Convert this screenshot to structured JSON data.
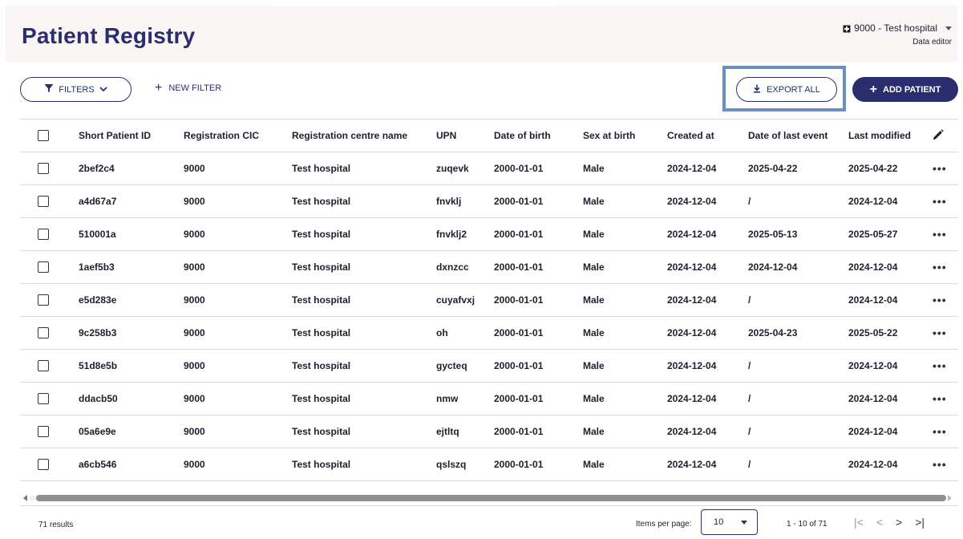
{
  "header": {
    "title": "Patient Registry",
    "hospital": "9000 - Test hospital",
    "role": "Data editor"
  },
  "toolbar": {
    "filters_label": "FILTERS",
    "new_filter_label": "NEW FILTER",
    "export_label": "EXPORT ALL",
    "add_label": "ADD PATIENT"
  },
  "table": {
    "columns": [
      "Short Patient ID",
      "Registration CIC",
      "Registration centre name",
      "UPN",
      "Date of birth",
      "Sex at birth",
      "Created at",
      "Date of last event",
      "Last modified"
    ],
    "rows": [
      [
        "2bef2c4",
        "9000",
        "Test hospital",
        "zuqevk",
        "2000-01-01",
        "Male",
        "2024-12-04",
        "2025-04-22",
        "2025-04-22"
      ],
      [
        "a4d67a7",
        "9000",
        "Test hospital",
        "fnvklj",
        "2000-01-01",
        "Male",
        "2024-12-04",
        "/",
        "2024-12-04"
      ],
      [
        "510001a",
        "9000",
        "Test hospital",
        "fnvklj2",
        "2000-01-01",
        "Male",
        "2024-12-04",
        "2025-05-13",
        "2025-05-27"
      ],
      [
        "1aef5b3",
        "9000",
        "Test hospital",
        "dxnzcc",
        "2000-01-01",
        "Male",
        "2024-12-04",
        "2024-12-04",
        "2024-12-04"
      ],
      [
        "e5d283e",
        "9000",
        "Test hospital",
        "cuyafvxj",
        "2000-01-01",
        "Male",
        "2024-12-04",
        "/",
        "2024-12-04"
      ],
      [
        "9c258b3",
        "9000",
        "Test hospital",
        "oh",
        "2000-01-01",
        "Male",
        "2024-12-04",
        "2025-04-23",
        "2025-05-22"
      ],
      [
        "51d8e5b",
        "9000",
        "Test hospital",
        "gycteq",
        "2000-01-01",
        "Male",
        "2024-12-04",
        "/",
        "2024-12-04"
      ],
      [
        "ddacb50",
        "9000",
        "Test hospital",
        "nmw",
        "2000-01-01",
        "Male",
        "2024-12-04",
        "/",
        "2024-12-04"
      ],
      [
        "05a6e9e",
        "9000",
        "Test hospital",
        "ejtltq",
        "2000-01-01",
        "Male",
        "2024-12-04",
        "/",
        "2024-12-04"
      ],
      [
        "a6cb546",
        "9000",
        "Test hospital",
        "qslszq",
        "2000-01-01",
        "Male",
        "2024-12-04",
        "/",
        "2024-12-04"
      ]
    ],
    "row_action": "•••"
  },
  "footer": {
    "results": "71 results",
    "items_per_page_label": "Items per page:",
    "items_per_page_value": "10",
    "range": "1 - 10 of 71"
  },
  "icons": {
    "hospital": "hospital-icon",
    "filter": "filter-icon",
    "download": "download-icon",
    "edit": "pencil-icon"
  },
  "colors": {
    "primary": "#2a2e6e",
    "header_bg": "#faf5f5",
    "highlight": "#6b8fc0"
  }
}
